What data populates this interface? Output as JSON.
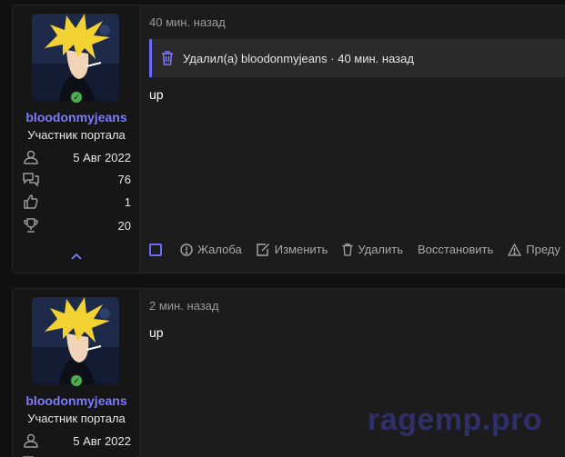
{
  "posts": [
    {
      "user": {
        "name": "bloodonmyjeans",
        "title": "Участник портала",
        "online_icon": "check-icon"
      },
      "stats": {
        "joined": "5 Авг 2022",
        "messages": "76",
        "reactions": "1",
        "points": "20"
      },
      "time": "40 мин. назад",
      "deleted_notice": "Удалил(а) bloodonmyjeans · 40 мин. назад",
      "text": "up",
      "actions": {
        "report": "Жалоба",
        "edit": "Изменить",
        "delete": "Удалить",
        "restore": "Восстановить",
        "warn": "Преду"
      }
    },
    {
      "user": {
        "name": "bloodonmyjeans",
        "title": "Участник портала"
      },
      "stats": {
        "joined": "5 Авг 2022"
      },
      "time": "2 мин. назад",
      "text": "up"
    }
  ],
  "watermark": "ragemp.pro",
  "colors": {
    "accent": "#7b7bff",
    "online": "#4caf50",
    "background": "#111111",
    "panel": "#1c1c1c"
  }
}
